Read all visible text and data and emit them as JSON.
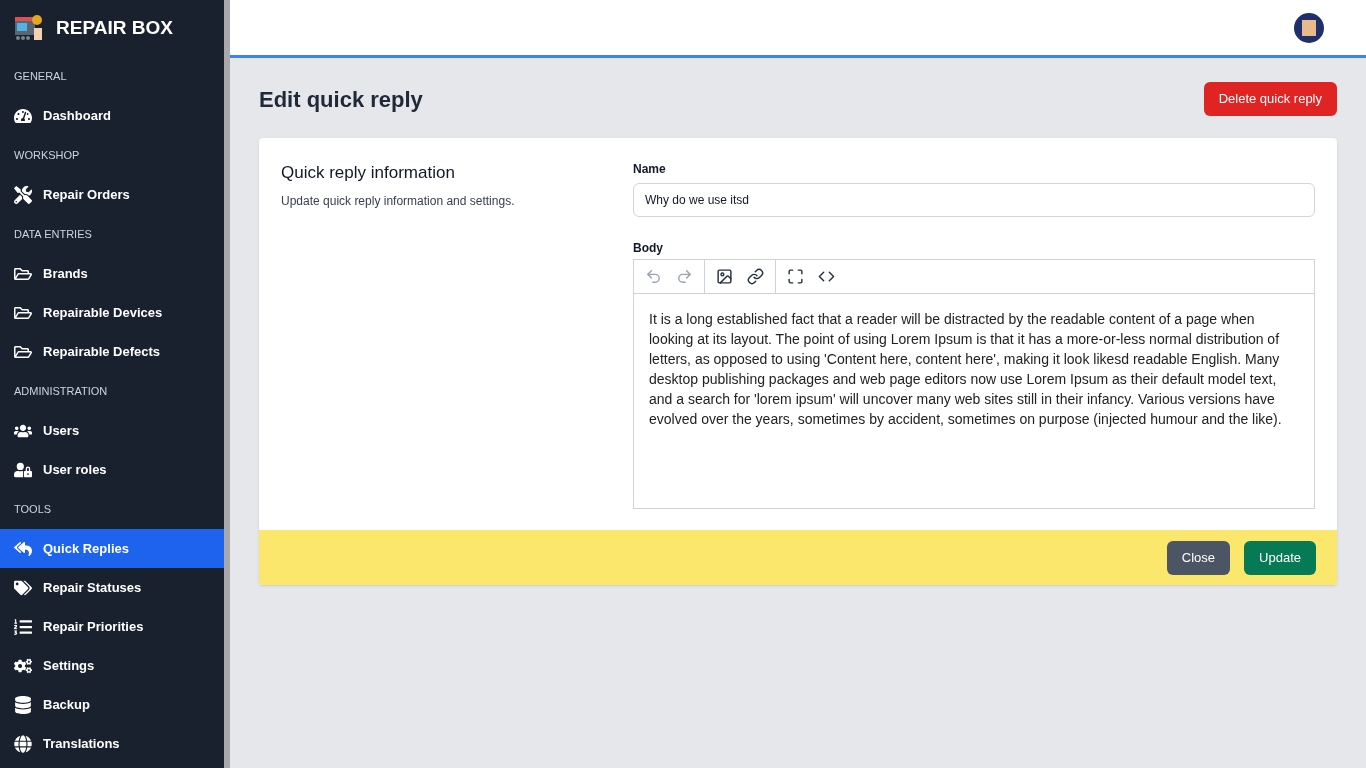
{
  "brand": {
    "name": "REPAIR BOX"
  },
  "sidebar": {
    "sections": [
      {
        "title": "GENERAL",
        "items": [
          {
            "label": "Dashboard",
            "selected": false
          }
        ]
      },
      {
        "title": "WORKSHOP",
        "items": [
          {
            "label": "Repair Orders",
            "selected": false
          }
        ]
      },
      {
        "title": "DATA ENTRIES",
        "items": [
          {
            "label": "Brands",
            "selected": false
          },
          {
            "label": "Repairable Devices",
            "selected": false
          },
          {
            "label": "Repairable Defects",
            "selected": false
          }
        ]
      },
      {
        "title": "ADMINISTRATION",
        "items": [
          {
            "label": "Users",
            "selected": false
          },
          {
            "label": "User roles",
            "selected": false
          }
        ]
      },
      {
        "title": "TOOLS",
        "items": [
          {
            "label": "Quick Replies",
            "selected": true
          },
          {
            "label": "Repair Statuses",
            "selected": false
          },
          {
            "label": "Repair Priorities",
            "selected": false
          },
          {
            "label": "Settings",
            "selected": false
          },
          {
            "label": "Backup",
            "selected": false
          },
          {
            "label": "Translations",
            "selected": false
          }
        ]
      }
    ]
  },
  "page": {
    "title": "Edit quick reply",
    "delete_button": "Delete quick reply"
  },
  "form": {
    "section_title": "Quick reply information",
    "section_description": "Update quick reply information and settings.",
    "name": {
      "label": "Name",
      "value": "Why do we use itsd"
    },
    "body": {
      "label": "Body",
      "toolbar": [
        {
          "disabled": true
        },
        {
          "disabled": true
        },
        {
          "disabled": false
        },
        {
          "disabled": false
        },
        {
          "disabled": false
        },
        {
          "disabled": false
        }
      ],
      "value": "It is a long established fact that a reader will be distracted by the readable content of a page when looking at its layout. The point of using Lorem Ipsum is that it has a more-or-less normal distribution of letters, as opposed to using 'Content here, content here', making it look likesd readable English. Many desktop publishing packages and web page editors now use Lorem Ipsum as their default model text, and a search for 'lorem ipsum' will uncover many web sites still in their infancy. Various versions have evolved over the years, sometimes by accident, sometimes on purpose (injected humour and the like)."
    },
    "buttons": [
      "Close",
      "Update"
    ]
  }
}
